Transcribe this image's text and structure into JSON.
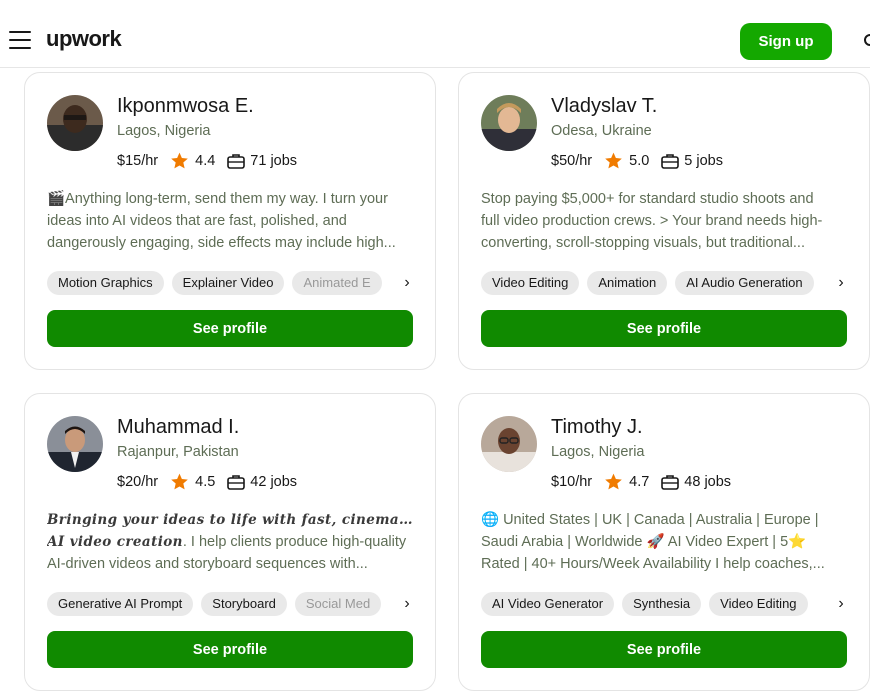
{
  "header": {
    "logo": "upwork",
    "signup_label": "Sign up"
  },
  "cards": [
    {
      "name": "Ikponmwosa E.",
      "location": "Lagos, Nigeria",
      "rate": "$15/hr",
      "rating": "4.4",
      "jobs": "71 jobs",
      "desc_lines": [
        "🎬Anything long-term, send them my way. I turn your",
        "ideas into AI videos that are fast, polished, and",
        "dangerously engaging, side effects may include high..."
      ],
      "skills": [
        "Motion Graphics",
        "Explainer Video",
        "Animated E"
      ],
      "cta": "See profile"
    },
    {
      "name": "Vladyslav T.",
      "location": "Odesa, Ukraine",
      "rate": "$50/hr",
      "rating": "5.0",
      "jobs": "5 jobs",
      "desc_lines": [
        "Stop paying $5,000+ for standard studio shoots and",
        "full video production crews. > Your brand needs high-",
        "converting, scroll-stopping visuals, but traditional..."
      ],
      "skills": [
        "Video Editing",
        "Animation",
        "AI Audio Generation"
      ],
      "cta": "See profile"
    },
    {
      "name": "Muhammad I.",
      "location": "Rajanpur, Pakistan",
      "rate": "$20/hr",
      "rating": "4.5",
      "jobs": "42 jobs",
      "desc_line1_styled": "Bringing your ideas to life with fast, cinematic",
      "desc_line2_styled": "AI video creation",
      "desc_line2_rest": ". I help clients produce high-quality",
      "desc_line3": "AI-driven videos and storyboard sequences with...",
      "skills": [
        "Generative AI Prompt",
        "Storyboard",
        "Social Med"
      ],
      "cta": "See profile"
    },
    {
      "name": "Timothy J.",
      "location": "Lagos, Nigeria",
      "rate": "$10/hr",
      "rating": "4.7",
      "jobs": "48 jobs",
      "desc_lines": [
        "🌐 United States | UK | Canada | Australia | Europe |",
        "Saudi Arabia | Worldwide 🚀 AI Video Expert | 5⭐",
        "Rated | 40+ Hours/Week Availability I help coaches,..."
      ],
      "skills": [
        "AI Video Generator",
        "Synthesia",
        "Video Editing"
      ],
      "cta": "See profile"
    }
  ],
  "colors": {
    "brand_green": "#14a800",
    "button_green": "#108a00",
    "star": "#f07b00"
  },
  "icons": [
    "menu-icon",
    "search-icon",
    "star-icon",
    "briefcase-icon",
    "chevron-right-icon"
  ]
}
